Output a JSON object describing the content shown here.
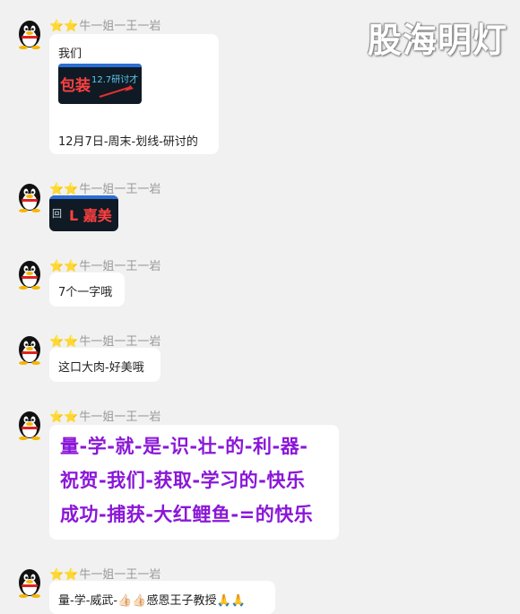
{
  "watermark": "股海明灯",
  "sender": {
    "stars": "⭐⭐",
    "name": "牛一姐一王一岩"
  },
  "messages": [
    {
      "text1": "我们",
      "thumb_red": "包装",
      "thumb_cyan": "12.7研讨才",
      "text2": "12月7日-周末-划线-研讨的"
    },
    {
      "thumb_red": "L 嘉美",
      "thumb_cyan": "回"
    },
    {
      "text": "7个一字哦"
    },
    {
      "text": "这口大肉-好美哦"
    },
    {
      "lines": [
        "量-学-就-是-识-壮-的-利-器-",
        "祝贺-我们-获取-学习的-快乐",
        "成功-捕获-大红鲤鱼-=的快乐"
      ]
    },
    {
      "text": "量-学-威武-👍🏻👍🏻感恩王子教授🙏🙏"
    }
  ]
}
